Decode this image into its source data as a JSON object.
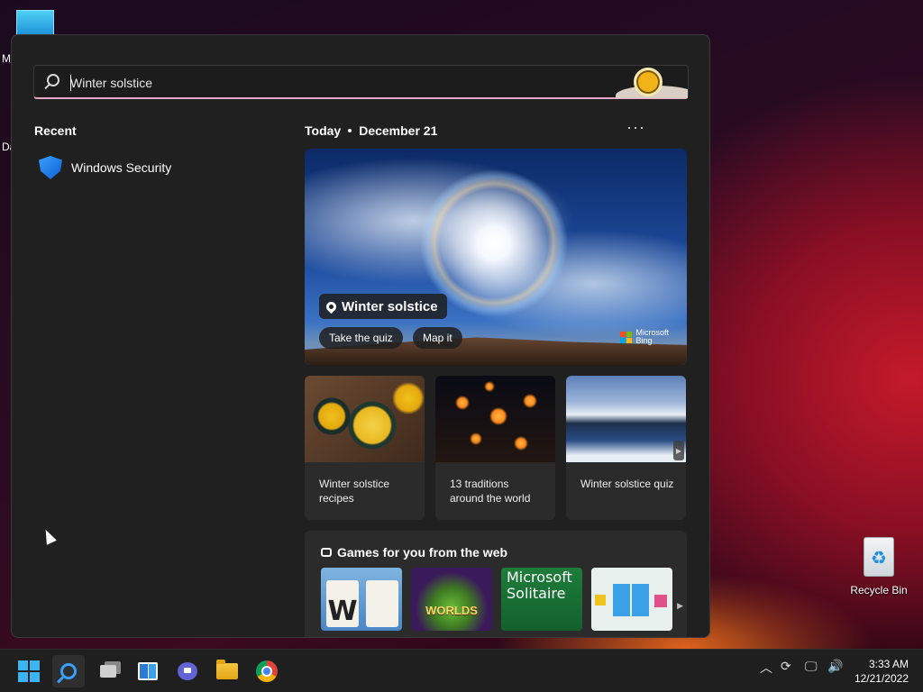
{
  "desktop": {
    "fragment_m": "M",
    "fragment_da": "Da",
    "recycle_bin_label": "Recycle Bin"
  },
  "search": {
    "value": "Winter solstice",
    "doodle_icon": "winter-solstice-sun-icon"
  },
  "recent": {
    "heading": "Recent",
    "items": [
      {
        "label": "Windows Security",
        "icon": "shield-icon"
      }
    ]
  },
  "today": {
    "label": "Today",
    "date": "December 21",
    "more": "···"
  },
  "hero": {
    "title": "Winter solstice",
    "buttons": [
      "Take the quiz",
      "Map it"
    ],
    "brand_line1": "Microsoft",
    "brand_line2": "Bing"
  },
  "cards": [
    {
      "caption": "Winter solstice recipes"
    },
    {
      "caption": "13 traditions around the world"
    },
    {
      "caption": "Winter solstice quiz"
    }
  ],
  "games": {
    "heading": "Games for you from the web",
    "tiles": [
      {
        "name": "words-game",
        "text": "W"
      },
      {
        "name": "worlds-game",
        "text": "WORLDS"
      },
      {
        "name": "microsoft-solitaire",
        "text": "Microsoft Solitaire"
      },
      {
        "name": "block-puzzle",
        "text": ""
      }
    ]
  },
  "taskbar": {
    "icons": [
      "windows-start-icon",
      "search-icon",
      "task-view-icon",
      "widgets-icon",
      "teams-chat-icon",
      "file-explorer-icon",
      "chrome-icon"
    ],
    "time": "3:33 AM",
    "date": "12/21/2022"
  },
  "colors": {
    "panel_bg": "#202020",
    "accent_underline": "#e7a7c9",
    "taskbar_bg": "#1f1f1f"
  }
}
